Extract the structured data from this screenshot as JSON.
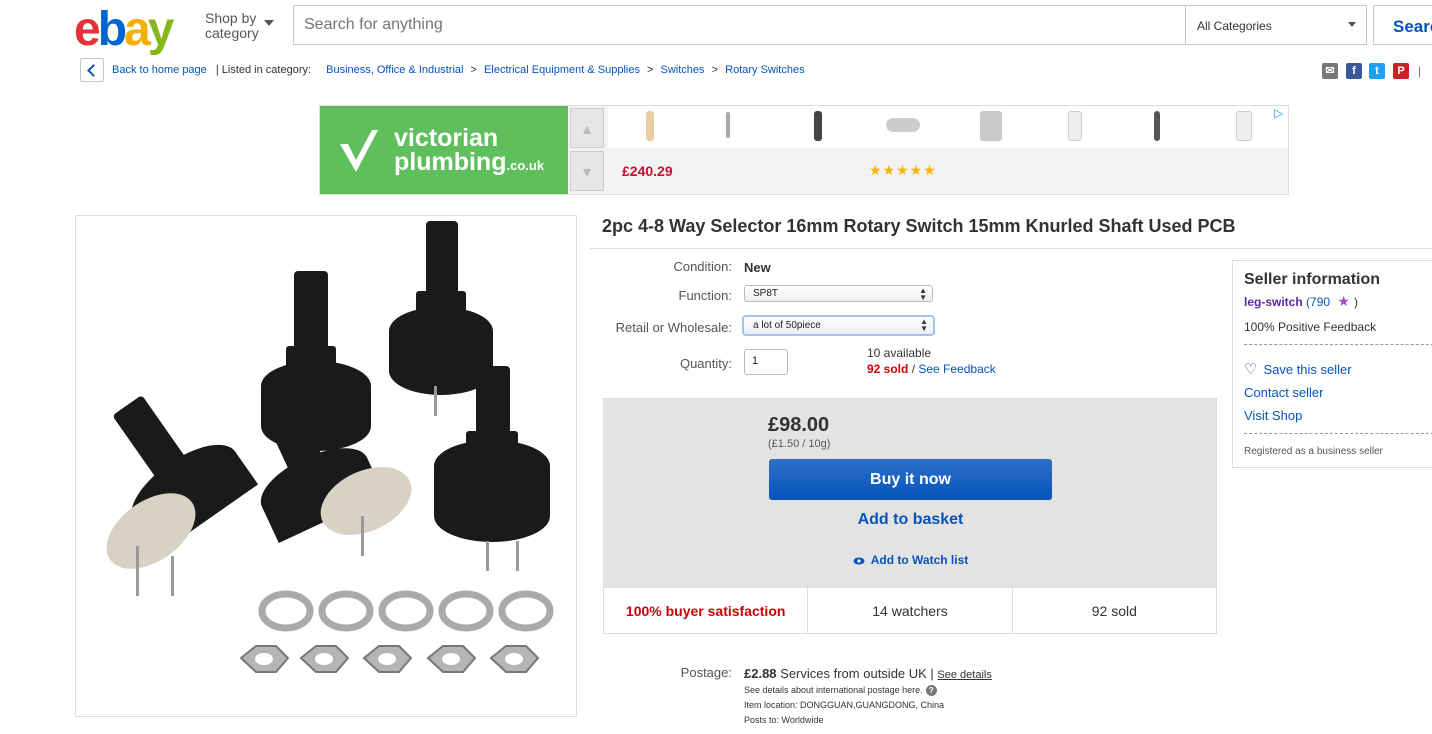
{
  "header": {
    "logo": {
      "e": "e",
      "b": "b",
      "a": "a",
      "y": "y"
    },
    "shop_by_line1": "Shop by",
    "shop_by_line2": "category",
    "search_placeholder": "Search for anything",
    "category_select": "All Categories",
    "search_button": "Searc"
  },
  "breadcrumb": {
    "back": "Back to home page",
    "listed_in": "| Listed in category:",
    "items": [
      "Business, Office & Industrial",
      "Electrical Equipment & Supplies",
      "Switches",
      "Rotary Switches"
    ],
    "separator": ">"
  },
  "share": {
    "email_icon": "✉",
    "facebook_icon": "f",
    "twitter_icon": "t",
    "pinterest_icon": "P",
    "divider": "|"
  },
  "ad": {
    "brand_line1": "victorian",
    "brand_line2": "plumbing",
    "brand_suffix": ".co.uk",
    "price": "£240.29",
    "stars": "★★★★★",
    "up_arrow": "▲",
    "down_arrow": "▼",
    "choices_icon": "▷"
  },
  "listing": {
    "title": "2pc 4-8 Way Selector 16mm Rotary Switch 15mm Knurled Shaft Used PCB",
    "condition_label": "Condition:",
    "condition_value": "New",
    "function_label": "Function:",
    "function_value": "SP8T",
    "retail_label": "Retail or Wholesale:",
    "retail_value": "a lot of 50piece",
    "quantity_label": "Quantity:",
    "quantity_value": "1",
    "available": "10 available",
    "sold": "92 sold",
    "sold_sep": " / ",
    "see_feedback": "See Feedback"
  },
  "buybox": {
    "price": "£98.00",
    "unit_price": "(£1.50 / 10g)",
    "buy_now": "Buy it now",
    "add_basket": "Add to basket",
    "watch": "Add to Watch list",
    "stats": [
      "100% buyer satisfaction",
      "14 watchers",
      "92 sold"
    ]
  },
  "postage": {
    "label": "Postage:",
    "price": "£2.88",
    "service": " Services from outside UK | ",
    "see_details": "See details",
    "intl": "See details about international postage here.",
    "help": "?",
    "location": "Item location:  DONGGUAN,GUANGDONG, China",
    "posts_to": "Posts to:  Worldwide"
  },
  "seller": {
    "heading": "Seller information",
    "name": "leg-switch",
    "count": " (790 ",
    "count_close": ")",
    "star": "★",
    "feedback": "100% Positive Feedback",
    "heart": "♡",
    "save": "Save this seller",
    "contact": "Contact seller",
    "visit": "Visit Shop",
    "registered": "Registered as a business seller"
  },
  "colors": {
    "accent": "#0654ba",
    "ad_green": "#5fbf5c",
    "sold_red": "#cc0000",
    "seller_purple": "#5a2a9c"
  }
}
